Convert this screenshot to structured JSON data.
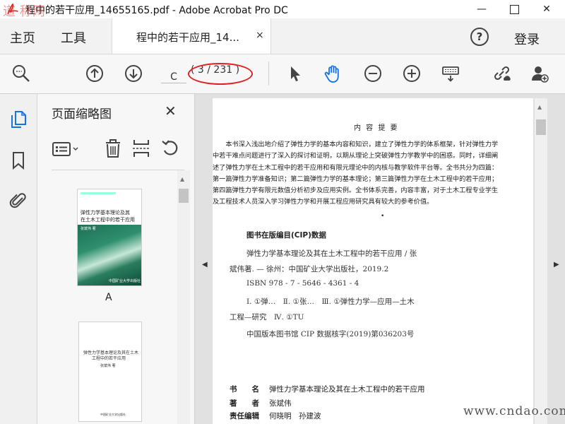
{
  "window": {
    "title": "程中的若干应用_14655165.pdf - Adobe Acrobat Pro DC",
    "minimize": "—",
    "close": "✕"
  },
  "tabs": {
    "home": "主页",
    "tools": "工具",
    "document": "程中的若干应用_14...",
    "document_close": "×",
    "help": "?",
    "login": "登录"
  },
  "toolbar": {
    "page_current": "C",
    "page_count": "( 3 / 231 )",
    "icons": [
      "search-zoom-icon",
      "page-up-icon",
      "page-down-icon",
      "select-pointer-icon",
      "hand-tool-icon",
      "zoom-out-icon",
      "zoom-in-icon",
      "keyboard-tools-icon",
      "share-link-icon",
      "add-user-icon"
    ]
  },
  "thumbnails": {
    "title": "页面缩略图",
    "close": "✕",
    "pages": [
      {
        "label": "A",
        "cover_title_1": "弹性力学基本理论及其",
        "cover_title_2": "在土木工程中的若干应用",
        "cover_author": "张斌伟  著",
        "cover_publisher": "中国矿业大学出版社"
      },
      {
        "label": "",
        "cover_title_1": "弹性力学基本理论及其在土木",
        "cover_title_2": "工程中的若干应用",
        "cover_author": "张斌伟  著",
        "cover_publisher": "中国矿业大学出版社"
      }
    ]
  },
  "page": {
    "heading": "内 容 提 要",
    "abstract": [
      "　　本书深入浅出地介绍了弹性力学的基本内容和知识，建立了弹性力学的体系框架，针对弹性力学",
      "中若干难点问题进行了深入的探讨和证明，以期从理论上突破弹性力学教学中的困惑。同时，详细阐",
      "述了弹性力学在土木工程中的若干应用和有限元理论中的内核与教学软件平台等。全书共分为四篇：",
      "第一篇弹性力学准备知识；第二篇弹性力学的基本理论；第三篇弹性力学在土木工程中的若干应用；",
      "第四篇弹性力学有限元数值分析初步及应用实例。全书体系完善，内容丰富，对于土木工程专业学生",
      "及工程技术人员深入学习弹性力学和开展工程应用研究具有较大的参考价值。"
    ],
    "dot": "•",
    "cip_heading": "图书在版编目(CIP)数据",
    "cip_lines": [
      "弹性力学基本理论及其在土木工程中的若干应用 / 张",
      "斌伟著. — 徐州：中国矿业大学出版社，2019.2",
      "ISBN 978 - 7 - 5646 - 4361 - 4",
      "Ⅰ. ①弹…　Ⅱ. ①张…　Ⅲ. ①弹性力学—应用—土木",
      "工程—研究　Ⅳ. ①TU",
      "中国版本图书馆 CIP 数据核字(2019)第036203号"
    ],
    "meta": [
      {
        "key": "书　　名",
        "value": "弹性力学基本理论及其在土木工程中的若干应用"
      },
      {
        "key": "著　　者",
        "value": "张斌伟"
      },
      {
        "key": "责任编辑",
        "value": "何晓明　孙建波"
      }
    ]
  },
  "watermarks": {
    "top": "道·称网",
    "bottom": "www.cndao.com"
  },
  "colors": {
    "accent_blue": "#1473e6",
    "highlight_red": "#e02020"
  }
}
